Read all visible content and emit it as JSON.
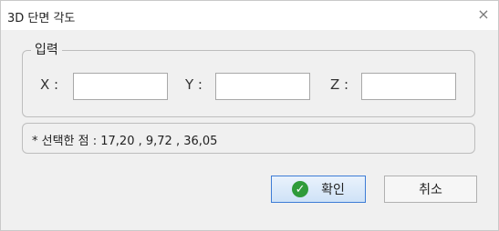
{
  "window": {
    "title": "3D 단면 각도",
    "close_symbol": "×"
  },
  "input_group": {
    "label": "입력",
    "fields": [
      {
        "label": "X :",
        "value": ""
      },
      {
        "label": "Y :",
        "value": ""
      },
      {
        "label": "Z :",
        "value": ""
      }
    ]
  },
  "info": {
    "text": "* 선택한 점 : 17,20 , 9,72 , 36,05"
  },
  "buttons": {
    "ok_label": "확인",
    "ok_icon": "check-circle-icon",
    "cancel_label": "취소"
  },
  "colors": {
    "ok_border": "#3d7cd6",
    "check_icon": "#2f9b3a"
  }
}
